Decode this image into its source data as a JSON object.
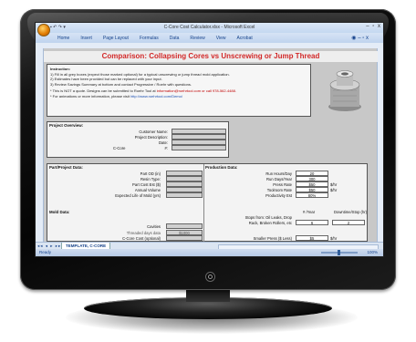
{
  "window": {
    "title": "C-Core Cost Calculator.xlsx - Microsoft Excel",
    "controls": "– ▫ x"
  },
  "ribbon": {
    "tabs": [
      "Home",
      "Insert",
      "Page Layout",
      "Formulas",
      "Data",
      "Review",
      "View",
      "Acrobat"
    ]
  },
  "sheet": {
    "banner": "Comparison: Collapsing Cores vs Unscrewing or Jump Thread",
    "instructions": {
      "heading": "Instruction:",
      "line1": "1) Fill in all grey boxes (expect those marked optional) for a typical unscrewing or jump thread mold application.",
      "line2": "2) Estimates have been provided but can be replaced with your input.",
      "line3": "3) Review Savings Summary at bottom and contact Progressive / Roehr with questions.",
      "note1_prefix": "* This is NOT a quote. Designs can be submitted to Roehr Tool at",
      "note1_contact": "information@roehrtool.com or call 978-562-4488.",
      "note2_prefix": "* For animations or more information, please visit",
      "note2_link": "http://www.roehrtool.com/Demo/"
    },
    "project_overview": {
      "title": "Project Overview:",
      "fields": [
        "Customer Name:",
        "Project Description:",
        "Date:",
        "C-Core                                     #:"
      ]
    },
    "part_project": {
      "title": "Part/Project Data:",
      "fields": [
        "Part OD (in)",
        "Resin Type:",
        "Part Cost Est ($)",
        "Annual Volume",
        "Expected Life of Mold (yrs)"
      ]
    },
    "production": {
      "title": "Production Data:",
      "fields": [
        "Run Hours/Day",
        "Run Days/Year",
        "Press Rate",
        "Toolroom Rate",
        "Productivity Est"
      ],
      "values": [
        "20",
        "300",
        "$50",
        "$50",
        "80%"
      ],
      "units": [
        "",
        "",
        "$/hr",
        "$/hr",
        ""
      ]
    },
    "mold": {
      "title": "Mold Data:",
      "fields": [
        "Cavities",
        "Threaded days data",
        "C-Core Cost (optional)"
      ],
      "value_threaded": "$1000",
      "col1": "# /Year",
      "col2": "Downtime/Stop (hr)",
      "stops_label": "Stops from: Oil Leaks, Drop",
      "stops_label2": "Rack, Broken Rollers, etc",
      "stops_value1": "6",
      "stops_value2": "2",
      "smaller_press_label": "Smaller Press ($ Less)",
      "smaller_press_value": "$5",
      "smaller_press_unit": "$/hr"
    }
  },
  "tabbar": {
    "nav": "◂◂ ◂ ▸ ▸▸",
    "sheet_tab": "TEMPLATE, C-CORE"
  },
  "statusbar": {
    "ready": "Ready",
    "zoom": "100%"
  }
}
